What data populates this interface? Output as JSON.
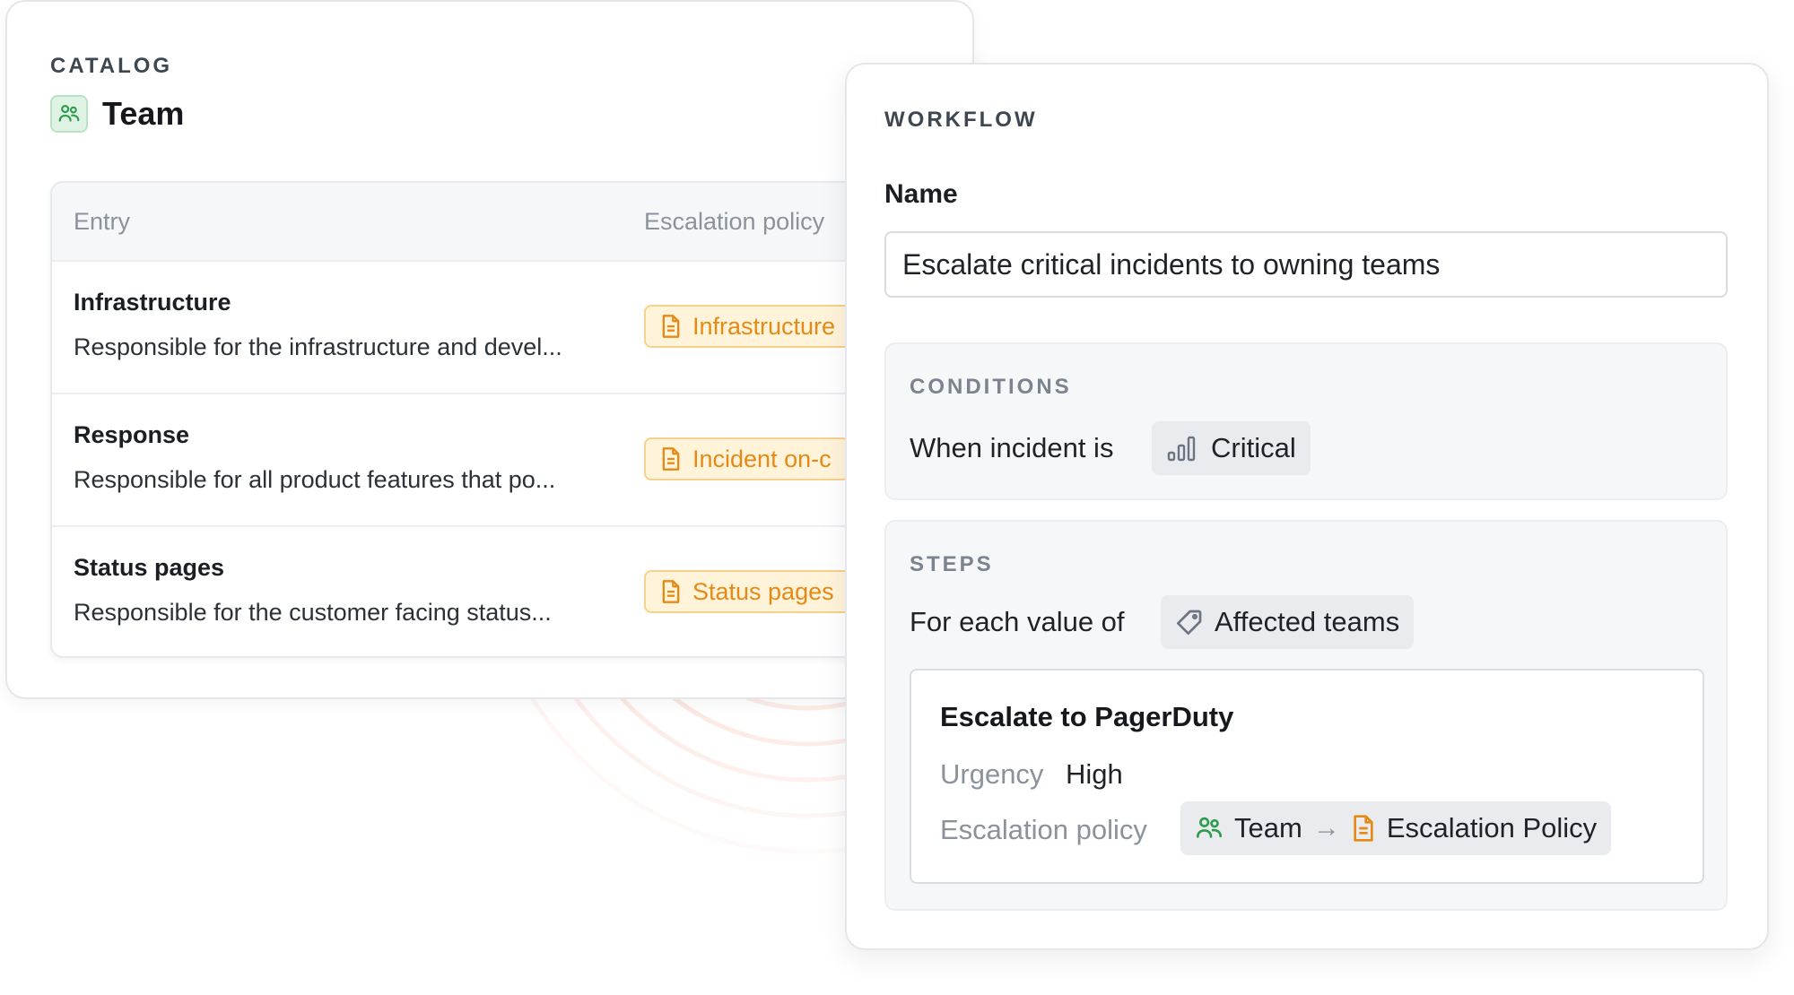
{
  "catalog": {
    "section_label": "CATALOG",
    "title": "Team",
    "columns": {
      "entry": "Entry",
      "escalation_policy": "Escalation policy"
    },
    "rows": [
      {
        "name": "Infrastructure",
        "description": "Responsible for the infrastructure and devel...",
        "policy": "Infrastructure"
      },
      {
        "name": "Response",
        "description": "Responsible for all product features that po...",
        "policy": "Incident on-c"
      },
      {
        "name": "Status pages",
        "description": "Responsible for the customer facing status...",
        "policy": "Status pages"
      }
    ]
  },
  "workflow": {
    "section_label": "WORKFLOW",
    "name_label": "Name",
    "name_value": "Escalate critical incidents to owning teams",
    "conditions": {
      "section_label": "CONDITIONS",
      "prefix": "When incident is",
      "severity": "Critical"
    },
    "steps": {
      "section_label": "STEPS",
      "prefix": "For each value of",
      "attribute": "Affected teams",
      "step": {
        "title": "Escalate to PagerDuty",
        "urgency_label": "Urgency",
        "urgency_value": "High",
        "policy_label": "Escalation policy",
        "policy_source": "Team",
        "policy_target": "Escalation Policy"
      }
    }
  },
  "colors": {
    "accent_orange": "#e68a16",
    "badge_bg": "#fff3d9",
    "team_green": "#2e9b4f",
    "ring_color": "#f08a6c"
  },
  "icons": [
    "team-icon",
    "document-icon",
    "severity-bars-icon",
    "tag-icon",
    "arrow-right-icon"
  ]
}
